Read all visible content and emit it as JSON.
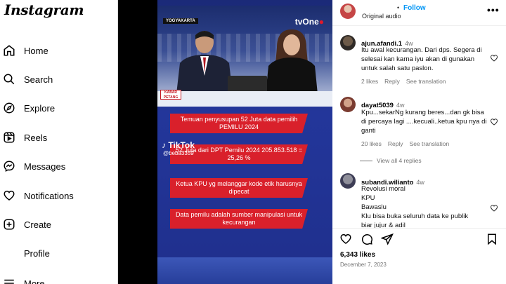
{
  "sidebar": {
    "logo": "Instagram",
    "items": [
      {
        "label": "Home",
        "icon": "home-icon"
      },
      {
        "label": "Search",
        "icon": "search-icon"
      },
      {
        "label": "Explore",
        "icon": "compass-icon"
      },
      {
        "label": "Reels",
        "icon": "reels-icon"
      },
      {
        "label": "Messages",
        "icon": "messenger-icon"
      },
      {
        "label": "Notifications",
        "icon": "heart-icon"
      },
      {
        "label": "Create",
        "icon": "plus-square-icon"
      },
      {
        "label": "Profile",
        "icon": "profile-avatar"
      },
      {
        "label": "More",
        "icon": "menu-icon"
      }
    ]
  },
  "video": {
    "location_tag": "YOGYAKARTA",
    "channel": "tvOne",
    "program_tag": "KABAR PETANG",
    "tiktok_brand": "TikTok",
    "tiktok_handle": "@beba3359",
    "banners": [
      "Temuan penyusupan 52 Juta data pemilih PEMILU 2024",
      "52 Juta dari DPT Pemilu 2024 205.853.518 = 25,26 %",
      "Ketua KPU yg melanggar kode etik harusnya dipecat",
      "Data pemilu adalah sumber manipulasi untuk kecurangan"
    ]
  },
  "post": {
    "follow_label": "Follow",
    "separator": "•",
    "audio": "Original audio",
    "more": "•••",
    "likes": "6,343 likes",
    "date": "December 7, 2023",
    "view_replies": "View all 4 replies"
  },
  "comments": [
    {
      "user": "ajun.afandi.1",
      "time": "4w",
      "text": "Itu awal kecurangan. Dari dps. Segera di selesai kan karna iyu akan di gunakan untuk salah satu paslon.",
      "likes": "2 likes",
      "reply": "Reply",
      "translate": "See translation"
    },
    {
      "user": "dayat5039",
      "time": "4w",
      "text": "Kpu...sekarNg kurang beres...dan gk bisa di percaya lagi ....kecuali..ketua kpu nya di ganti",
      "likes": "20 likes",
      "reply": "Reply",
      "translate": "See translation"
    },
    {
      "user": "subandi.wilianto",
      "time": "4w",
      "lines": [
        "Revolusi moral",
        "KPU",
        "Bawaslu",
        "Klu bisa buka seluruh data ke publik",
        "biar jujur & adil"
      ]
    }
  ]
}
